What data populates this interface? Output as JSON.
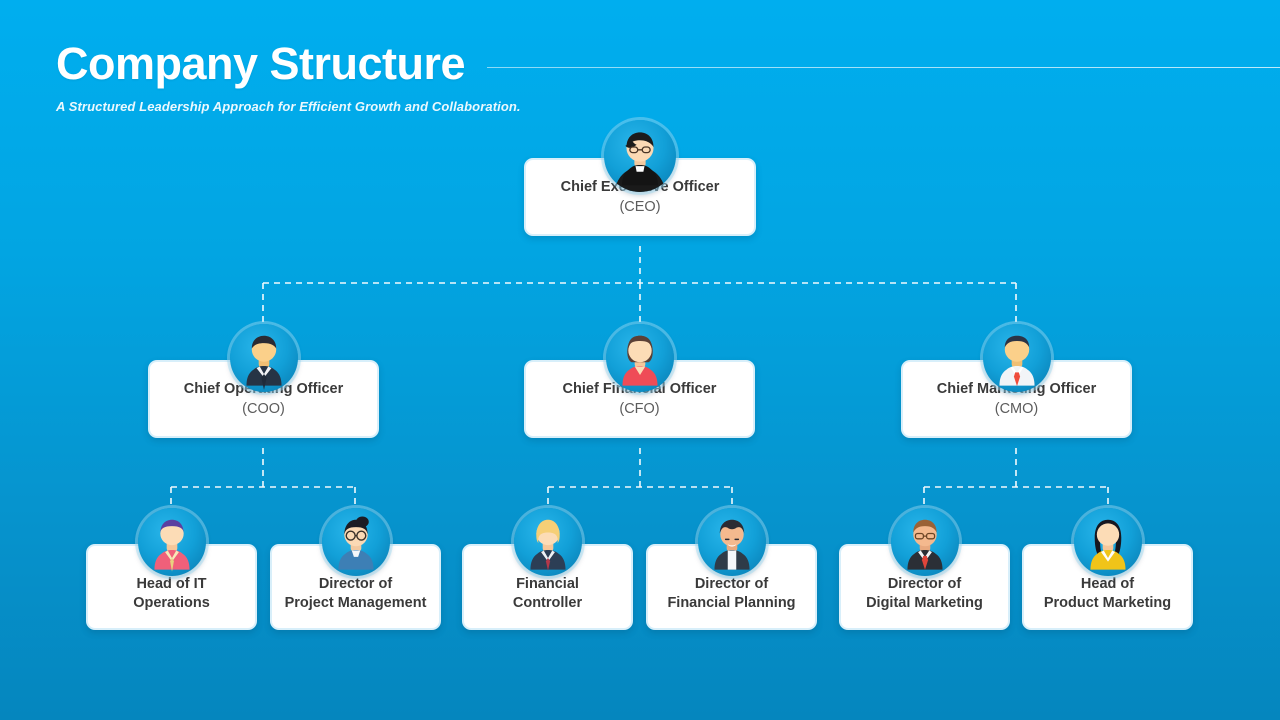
{
  "header": {
    "title": "Company Structure",
    "subtitle": "A Structured Leadership Approach for Efficient Growth and Collaboration."
  },
  "theme": {
    "bg_top": "#00AEEF",
    "bg_bottom": "#0586BE",
    "card_bg": "#FFFFFF",
    "title_text": "#3A3A3A",
    "sub_text": "#5C5C5C",
    "connector": "#FFFFFF",
    "avatar_ring": "#A0DCF5"
  },
  "org": {
    "ceo": {
      "title": "Chief Executive Officer",
      "acronym": "(CEO)",
      "avatar": "avatar-ceo-glasses-black-sweater"
    },
    "level2": [
      {
        "title": "Chief Operating Officer",
        "acronym": "(COO)",
        "avatar": "avatar-coo-man-navy-suit",
        "reports": [
          {
            "title": "Head of IT\nOperations",
            "avatar": "avatar-woman-purple-hair-coral-blazer"
          },
          {
            "title": "Director of\nProject Management",
            "avatar": "avatar-person-glasses-bun-blue-top"
          }
        ]
      },
      {
        "title": "Chief Financial Officer",
        "acronym": "(CFO)",
        "avatar": "avatar-cfo-woman-red-top",
        "reports": [
          {
            "title": "Financial\nController",
            "avatar": "avatar-blonde-woman-dark-suit"
          },
          {
            "title": "Director of\nFinancial Planning",
            "avatar": "avatar-man-dark-jacket-white-shirt"
          }
        ]
      },
      {
        "title": "Chief Marketing Officer",
        "acronym": "(CMO)",
        "avatar": "avatar-cmo-man-red-tie",
        "reports": [
          {
            "title": "Director of\nDigital Marketing",
            "avatar": "avatar-man-glasses-red-tie"
          },
          {
            "title": "Head of\nProduct Marketing",
            "avatar": "avatar-woman-long-hair-yellow-top"
          }
        ]
      }
    ]
  }
}
